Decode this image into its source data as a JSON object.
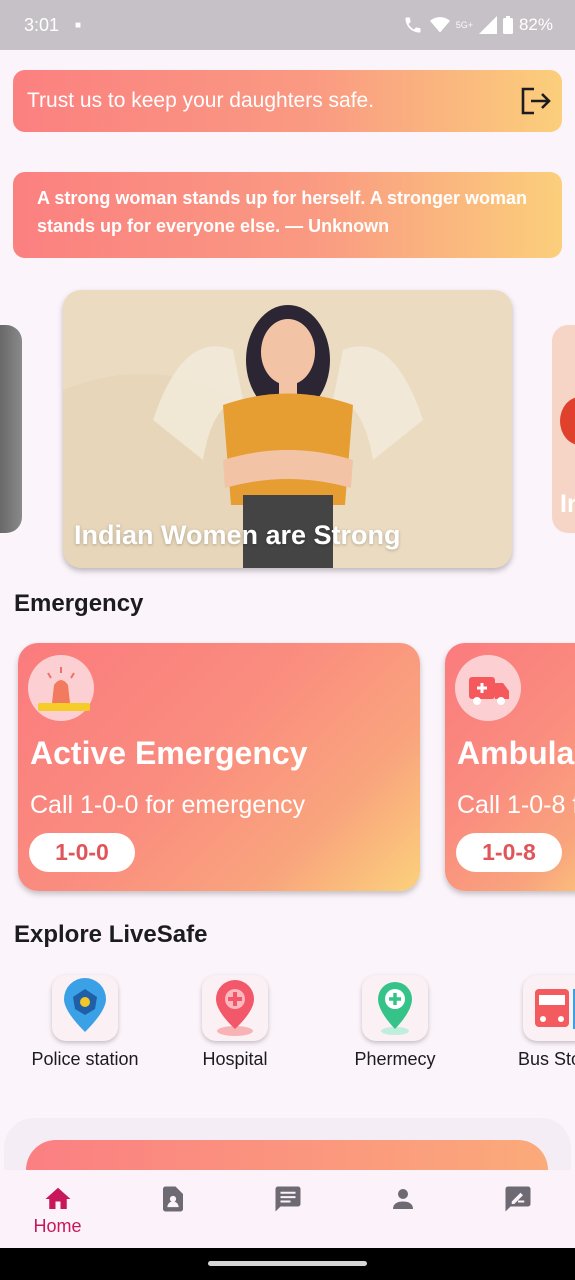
{
  "status_bar": {
    "time": "3:01",
    "signal_label": "5G+",
    "battery": "82%"
  },
  "banner_top": {
    "text": "Trust us to keep your daughters safe."
  },
  "quote_banner": {
    "text": "A strong woman stands up for herself. A stronger woman stands up for everyone else. — Unknown"
  },
  "carousel": {
    "main_caption": "Indian Women are Strong",
    "right_peek_text": "In"
  },
  "emergency": {
    "section_title": "Emergency",
    "cards": [
      {
        "title": "Active Emergency",
        "subtitle": "Call 1-0-0 for emergency",
        "number": "1-0-0",
        "icon": "siren-icon"
      },
      {
        "title": "Ambula",
        "subtitle": "Call 1-0-8 f",
        "number": "1-0-8",
        "icon": "ambulance-icon"
      }
    ]
  },
  "explore": {
    "section_title": "Explore LiveSafe",
    "items": [
      {
        "label": "Police station",
        "icon": "police-station-icon"
      },
      {
        "label": "Hospital",
        "icon": "hospital-icon"
      },
      {
        "label": "Phermecy",
        "icon": "pharmacy-icon"
      },
      {
        "label": "Bus Sto",
        "icon": "bus-stop-icon"
      }
    ]
  },
  "bottom_nav": {
    "items": [
      {
        "label": "Home",
        "icon": "home-icon",
        "active": true
      },
      {
        "label": "",
        "icon": "contacts-icon"
      },
      {
        "label": "",
        "icon": "chat-icon"
      },
      {
        "label": "",
        "icon": "profile-icon"
      },
      {
        "label": "",
        "icon": "review-icon"
      }
    ]
  },
  "colors": {
    "accent": "#c8185c",
    "gradient_start": "#fb7b7e",
    "gradient_end": "#fbd17b",
    "background": "#fbf4fb"
  }
}
